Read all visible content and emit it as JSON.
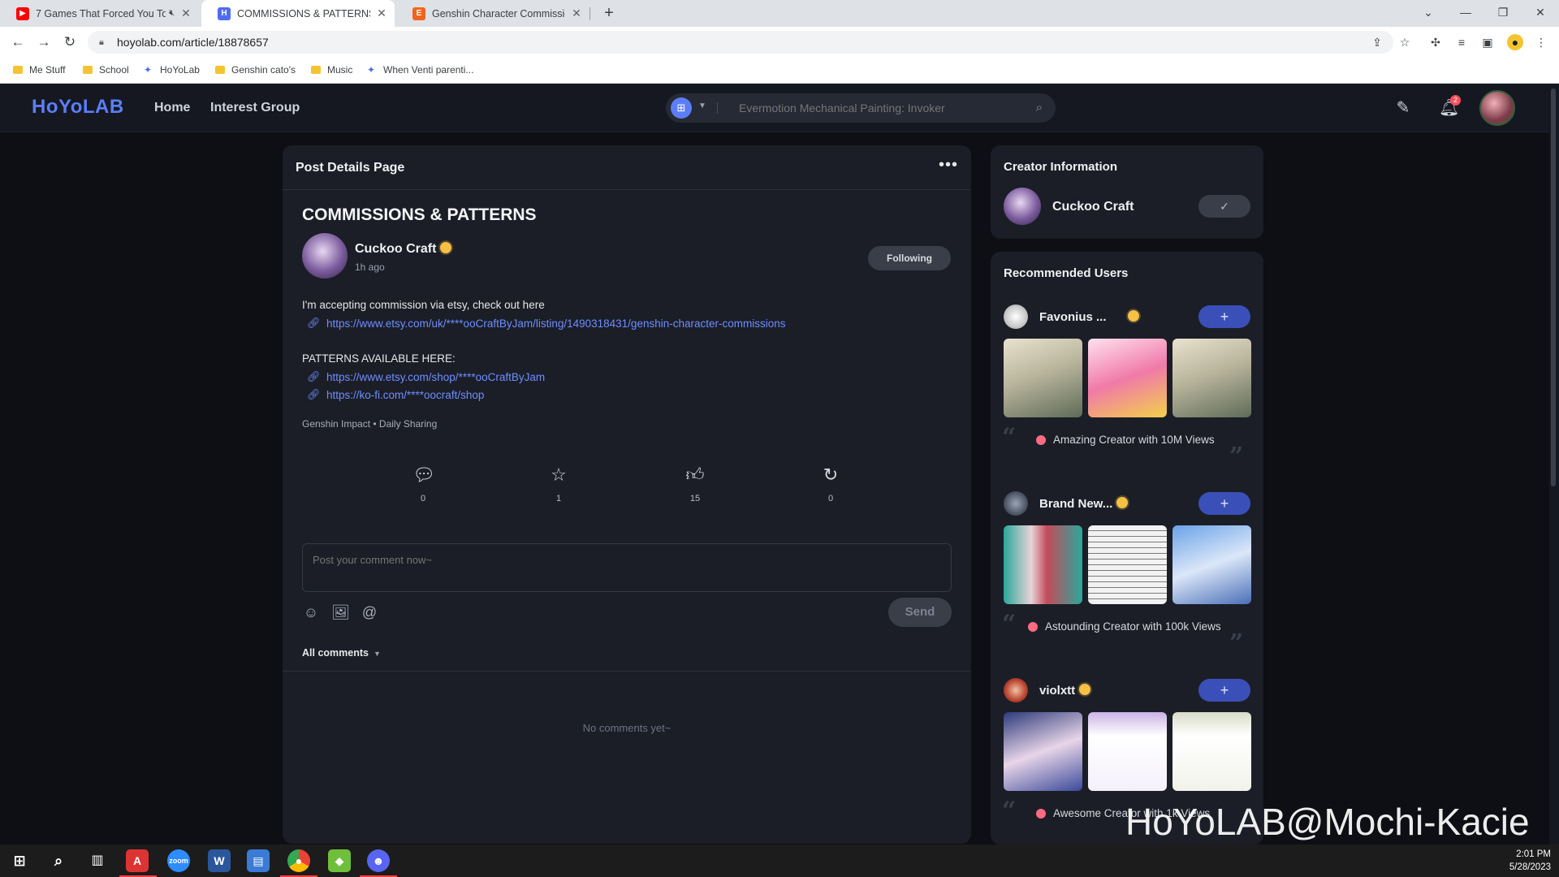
{
  "browser": {
    "tabs": [
      {
        "title": "7 Games That Forced You To",
        "favicon": "youtube-icon",
        "color": "#ff0000"
      },
      {
        "title": "COMMISSIONS & PATTERNS Ger",
        "favicon": "hoyolab-icon",
        "color": "#4f6bf0"
      },
      {
        "title": "Genshin Character Commissions",
        "favicon": "etsy-icon",
        "color": "#f1641e"
      }
    ],
    "url": "hoyolab.com/article/18878657",
    "bookmarks": [
      {
        "label": "Me Stuff",
        "type": "folder"
      },
      {
        "label": "School",
        "type": "folder"
      },
      {
        "label": "HoYoLab",
        "type": "site"
      },
      {
        "label": "Genshin cato's",
        "type": "folder"
      },
      {
        "label": "Music",
        "type": "folder"
      },
      {
        "label": "When Venti parenti...",
        "type": "site"
      }
    ]
  },
  "header": {
    "logo": "HoYoLAB",
    "nav": [
      "Home",
      "Interest Group"
    ],
    "search_placeholder": "Evermotion Mechanical Painting: Invoker",
    "notification_count": "2",
    "accent": "#5b7ef8"
  },
  "post": {
    "page_title": "Post Details Page",
    "title": "COMMISSIONS & PATTERNS",
    "author": "Cuckoo Craft",
    "time": "1h ago",
    "follow_label": "Following",
    "body_line1": "I'm accepting commission via etsy, check out here",
    "link1": "https://www.etsy.com/uk/****ooCraftByJam/listing/1490318431/genshin-character-commissions",
    "body_line2": "PATTERNS AVAILABLE HERE:",
    "link2": "https://www.etsy.com/shop/****ooCraftByJam",
    "link3": "https://ko-fi.com/****oocraft/shop",
    "tags": "Genshin Impact • Daily Sharing",
    "actions": [
      {
        "name": "comment",
        "count": "0"
      },
      {
        "name": "favorite",
        "count": "1"
      },
      {
        "name": "like",
        "count": "15"
      },
      {
        "name": "share",
        "count": "0"
      }
    ],
    "comment_placeholder": "Post your comment now~",
    "send_label": "Send",
    "comments_label": "All comments",
    "no_comments": "No comments yet~"
  },
  "sidebar": {
    "creator_title": "Creator Information",
    "creator_name": "Cuckoo Craft",
    "recommended_title": "Recommended Users",
    "users": [
      {
        "name": "Favonius ...",
        "badge": "Amazing Creator with 10M Views"
      },
      {
        "name": "Brand New...",
        "badge": "Astounding Creator with 100k Views"
      },
      {
        "name": "violxtt",
        "badge": "Awesome Creator with 1k Views"
      }
    ]
  },
  "watermark": "HoYoLAB@Mochi-Kacie",
  "taskbar": {
    "time": "2:01 PM",
    "date": "5/28/2023"
  }
}
